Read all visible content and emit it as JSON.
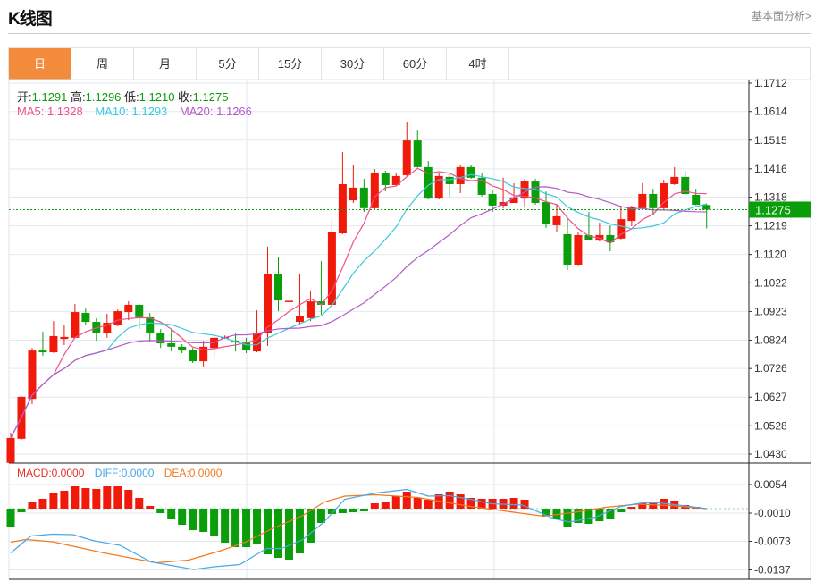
{
  "header": {
    "title": "K线图",
    "link": "基本面分析>"
  },
  "tabs": [
    {
      "label": "日",
      "active": true
    },
    {
      "label": "周"
    },
    {
      "label": "月"
    },
    {
      "label": "5分"
    },
    {
      "label": "15分"
    },
    {
      "label": "30分"
    },
    {
      "label": "60分"
    },
    {
      "label": "4时"
    }
  ],
  "ohlc_info": {
    "open_label": "开:",
    "open": "1.1291",
    "high_label": "高:",
    "high": "1.1296",
    "low_label": "低:",
    "low": "1.1210",
    "close_label": "收:",
    "close": "1.1275"
  },
  "ma_info": {
    "ma5": "MA5: 1.1328",
    "ma10": "MA10: 1.1293",
    "ma20": "MA20: 1.1266"
  },
  "macd_info": {
    "macd": "MACD:0.0000",
    "diff": "DIFF:0.0000",
    "dea": "DEA:0.0000"
  },
  "colors": {
    "up": "#f0190a",
    "down": "#0a9e0a",
    "ma5": "#f0508a",
    "ma10": "#3cc8e0",
    "ma20": "#b45ac8",
    "diff": "#4aa8e8",
    "dea": "#f07a20",
    "accent": "#f28c3c"
  },
  "chart_data": {
    "type": "candlestick",
    "price_axis": {
      "ticks": [
        "1.1712",
        "1.1614",
        "1.1515",
        "1.1416",
        "1.1318",
        "1.1219",
        "1.1120",
        "1.1022",
        "1.0923",
        "1.0824",
        "1.0726",
        "1.0627",
        "1.0528",
        "1.0430"
      ],
      "range": [
        1.043,
        1.1712
      ]
    },
    "last_price": "1.1275",
    "candles": [
      [
        1.04,
        1.0504,
        1.039,
        1.0486
      ],
      [
        1.0483,
        1.063,
        1.048,
        1.0628
      ],
      [
        1.0621,
        1.0797,
        1.0603,
        1.0788
      ],
      [
        1.0788,
        1.0853,
        1.077,
        1.0782
      ],
      [
        1.0782,
        1.089,
        1.078,
        1.0838
      ],
      [
        1.0828,
        1.0875,
        1.0807,
        1.0835
      ],
      [
        1.0832,
        1.0949,
        1.083,
        1.0921
      ],
      [
        1.0918,
        1.0933,
        1.0878,
        1.0887
      ],
      [
        1.0887,
        1.09,
        1.0822,
        1.085
      ],
      [
        1.085,
        1.0915,
        1.0832,
        1.0884
      ],
      [
        1.0875,
        1.093,
        1.0872,
        1.0924
      ],
      [
        1.0921,
        1.0958,
        1.0893,
        1.0946
      ],
      [
        1.0946,
        1.095,
        1.0862,
        1.0903
      ],
      [
        1.0903,
        1.0918,
        1.0816,
        1.0847
      ],
      [
        1.0847,
        1.0862,
        1.0797,
        1.0813
      ],
      [
        1.0813,
        1.0862,
        1.0785,
        1.0801
      ],
      [
        1.0801,
        1.081,
        1.0779,
        1.0788
      ],
      [
        1.0791,
        1.0797,
        1.0745,
        1.0751
      ],
      [
        1.0751,
        1.0822,
        1.0733,
        1.0801
      ],
      [
        1.0797,
        1.0847,
        1.0767,
        1.0832
      ],
      [
        1.0832,
        1.084,
        1.0828,
        1.0835
      ],
      [
        1.0822,
        1.085,
        1.0785,
        1.0816
      ],
      [
        1.0816,
        1.0832,
        1.0779,
        1.0791
      ],
      [
        1.0785,
        1.0927,
        1.0782,
        1.085
      ],
      [
        1.085,
        1.1147,
        1.0804,
        1.1054
      ],
      [
        1.1054,
        1.111,
        1.0924,
        1.0961
      ],
      [
        1.0956,
        1.096,
        1.0956,
        1.096
      ],
      [
        1.0887,
        1.1051,
        1.0881,
        1.0906
      ],
      [
        1.09,
        1.0992,
        1.089,
        1.0958
      ],
      [
        1.0958,
        1.1097,
        1.0912,
        1.0946
      ],
      [
        1.0946,
        1.1242,
        1.094,
        1.1199
      ],
      [
        1.1193,
        1.1474,
        1.119,
        1.1363
      ],
      [
        1.1307,
        1.1428,
        1.1298,
        1.1351
      ],
      [
        1.1351,
        1.1381,
        1.1267,
        1.128
      ],
      [
        1.128,
        1.1415,
        1.1275,
        1.14
      ],
      [
        1.14,
        1.1409,
        1.1338,
        1.136
      ],
      [
        1.136,
        1.14,
        1.1357,
        1.1391
      ],
      [
        1.1394,
        1.1576,
        1.139,
        1.1514
      ],
      [
        1.1514,
        1.1551,
        1.142,
        1.1422
      ],
      [
        1.1422,
        1.1443,
        1.131,
        1.1313
      ],
      [
        1.1313,
        1.14,
        1.131,
        1.1391
      ],
      [
        1.1388,
        1.1397,
        1.132,
        1.1363
      ],
      [
        1.1363,
        1.1428,
        1.1332,
        1.1422
      ],
      [
        1.1422,
        1.1428,
        1.1382,
        1.1385
      ],
      [
        1.1385,
        1.1403,
        1.132,
        1.1326
      ],
      [
        1.1329,
        1.1341,
        1.1267,
        1.1289
      ],
      [
        1.1289,
        1.1385,
        1.128,
        1.1301
      ],
      [
        1.1298,
        1.1366,
        1.1298,
        1.1317
      ],
      [
        1.1313,
        1.1381,
        1.1283,
        1.1372
      ],
      [
        1.1372,
        1.1381,
        1.1292,
        1.1298
      ],
      [
        1.1301,
        1.1338,
        1.1212,
        1.1224
      ],
      [
        1.1221,
        1.1295,
        1.1199,
        1.1252
      ],
      [
        1.119,
        1.1249,
        1.1066,
        1.1085
      ],
      [
        1.1085,
        1.1196,
        1.1083,
        1.1187
      ],
      [
        1.1187,
        1.1267,
        1.1168,
        1.1171
      ],
      [
        1.1168,
        1.123,
        1.1165,
        1.1187
      ],
      [
        1.1187,
        1.1221,
        1.1131,
        1.1162
      ],
      [
        1.1175,
        1.1289,
        1.1172,
        1.1242
      ],
      [
        1.1236,
        1.1289,
        1.1218,
        1.1283
      ],
      [
        1.128,
        1.1366,
        1.1277,
        1.1329
      ],
      [
        1.1329,
        1.1347,
        1.1258,
        1.128
      ],
      [
        1.128,
        1.1378,
        1.1277,
        1.1366
      ],
      [
        1.1363,
        1.1422,
        1.136,
        1.1388
      ],
      [
        1.1388,
        1.1409,
        1.1326,
        1.1329
      ],
      [
        1.1326,
        1.1347,
        1.129,
        1.1292
      ],
      [
        1.1291,
        1.1296,
        1.121,
        1.1275
      ]
    ],
    "macd_axis": {
      "ticks": [
        "0.0054",
        "-0.0010",
        "-0.0073",
        "-0.0137"
      ]
    },
    "macd_hist": [
      -0.004,
      -0.0008,
      0.0016,
      0.0022,
      0.0034,
      0.004,
      0.005,
      0.0046,
      0.0044,
      0.005,
      0.005,
      0.0042,
      0.0024,
      0.0006,
      -0.001,
      -0.0024,
      -0.0036,
      -0.0048,
      -0.0052,
      -0.0062,
      -0.0076,
      -0.0086,
      -0.0086,
      -0.008,
      -0.0102,
      -0.011,
      -0.0114,
      -0.01,
      -0.0076,
      -0.0032,
      -0.0012,
      -0.001,
      -0.0008,
      -0.0006,
      0.0012,
      0.0016,
      0.0028,
      0.0038,
      0.0024,
      0.002,
      0.0032,
      0.0038,
      0.0032,
      0.0024,
      0.0022,
      0.0022,
      0.0022,
      0.0024,
      0.002,
      0.0,
      -0.0016,
      -0.0022,
      -0.0042,
      -0.0032,
      -0.0034,
      -0.0028,
      -0.0024,
      -0.0008,
      0.0004,
      0.0012,
      0.0012,
      0.0022,
      0.0018,
      0.0008,
      0.0004,
      0.0
    ],
    "diff": [
      [
        0,
        -0.0099
      ],
      [
        1.9,
        -0.0061
      ],
      [
        3.9,
        -0.0057
      ],
      [
        5.8,
        -0.0058
      ],
      [
        7.8,
        -0.0072
      ],
      [
        10.2,
        -0.0082
      ],
      [
        13.1,
        -0.0119
      ],
      [
        17.1,
        -0.0136
      ],
      [
        19,
        -0.013
      ],
      [
        21.4,
        -0.0125
      ],
      [
        23.9,
        -0.0089
      ],
      [
        25.3,
        -0.0089
      ],
      [
        27.3,
        -0.0069
      ],
      [
        29.3,
        -0.0029
      ],
      [
        31.2,
        0.0021
      ],
      [
        34.1,
        0.0035
      ],
      [
        37,
        0.0043
      ],
      [
        39,
        0.0028
      ],
      [
        41,
        0.0029
      ],
      [
        42.9,
        0.0021
      ],
      [
        44.9,
        0.0011
      ],
      [
        47.8,
        0.0008
      ],
      [
        50.7,
        -0.0022
      ],
      [
        52.2,
        -0.003
      ],
      [
        54.6,
        -0.0019
      ],
      [
        57,
        0.0005
      ],
      [
        59,
        0.0013
      ],
      [
        60.5,
        0.0013
      ],
      [
        62.4,
        0.0008
      ],
      [
        65,
        0.0
      ]
    ],
    "dea": [
      [
        0,
        -0.0075
      ],
      [
        1.4,
        -0.0069
      ],
      [
        3.9,
        -0.0074
      ],
      [
        8.7,
        -0.0099
      ],
      [
        13.6,
        -0.0121
      ],
      [
        16.6,
        -0.0115
      ],
      [
        19.5,
        -0.0095
      ],
      [
        21.9,
        -0.0075
      ],
      [
        24.4,
        -0.0045
      ],
      [
        27.3,
        -0.0015
      ],
      [
        29.3,
        0.0015
      ],
      [
        31.2,
        0.0028
      ],
      [
        34.1,
        0.0031
      ],
      [
        38,
        0.0025
      ],
      [
        42.9,
        0.0005
      ],
      [
        49.8,
        -0.0017
      ],
      [
        52.7,
        -0.0008
      ],
      [
        55.6,
        0.0003
      ],
      [
        58.5,
        0.001
      ],
      [
        61.5,
        0.0007
      ],
      [
        65,
        0.0
      ]
    ]
  }
}
